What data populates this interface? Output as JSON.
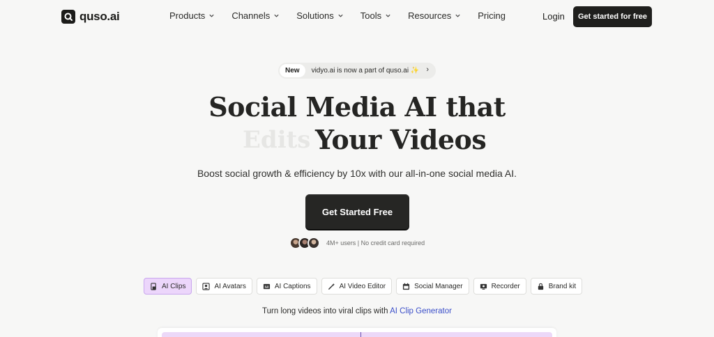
{
  "brand": {
    "name": "quso.ai"
  },
  "nav": {
    "items": [
      {
        "label": "Products",
        "has_dropdown": true
      },
      {
        "label": "Channels",
        "has_dropdown": true
      },
      {
        "label": "Solutions",
        "has_dropdown": true
      },
      {
        "label": "Tools",
        "has_dropdown": true
      },
      {
        "label": "Resources",
        "has_dropdown": true
      },
      {
        "label": "Pricing",
        "has_dropdown": false
      }
    ],
    "login_label": "Login",
    "cta_label": "Get started for free"
  },
  "announcement": {
    "badge": "New",
    "text": "vidyo.ai is now a part of quso.ai ✨",
    "arrow": "›"
  },
  "hero": {
    "headline_line1": "Social Media AI that",
    "rotating_word": "Edits",
    "headline_line2": "Your Videos",
    "subheadline": "Boost social growth & efficiency by 10x with our all-in-one social media AI.",
    "cta_label": "Get Started Free",
    "social_proof": "4M+ users | No credit card required"
  },
  "features": {
    "tabs": [
      {
        "label": "AI Clips",
        "icon": "clip-icon",
        "active": true
      },
      {
        "label": "AI Avatars",
        "icon": "avatar-icon",
        "active": false
      },
      {
        "label": "AI Captions",
        "icon": "captions-icon",
        "active": false
      },
      {
        "label": "AI Video Editor",
        "icon": "magic-wand-icon",
        "active": false
      },
      {
        "label": "Social Manager",
        "icon": "calendar-icon",
        "active": false
      },
      {
        "label": "Recorder",
        "icon": "recorder-icon",
        "active": false
      },
      {
        "label": "Brand kit",
        "icon": "brand-kit-icon",
        "active": false
      }
    ],
    "tagline_prefix": "Turn long videos into viral clips with",
    "tagline_link": "AI Clip Generator"
  },
  "colors": {
    "background": "#f7f7f6",
    "primary_button": "#1f1f1d",
    "active_tab": "#ecd6fb",
    "link": "#3b4fc9"
  }
}
